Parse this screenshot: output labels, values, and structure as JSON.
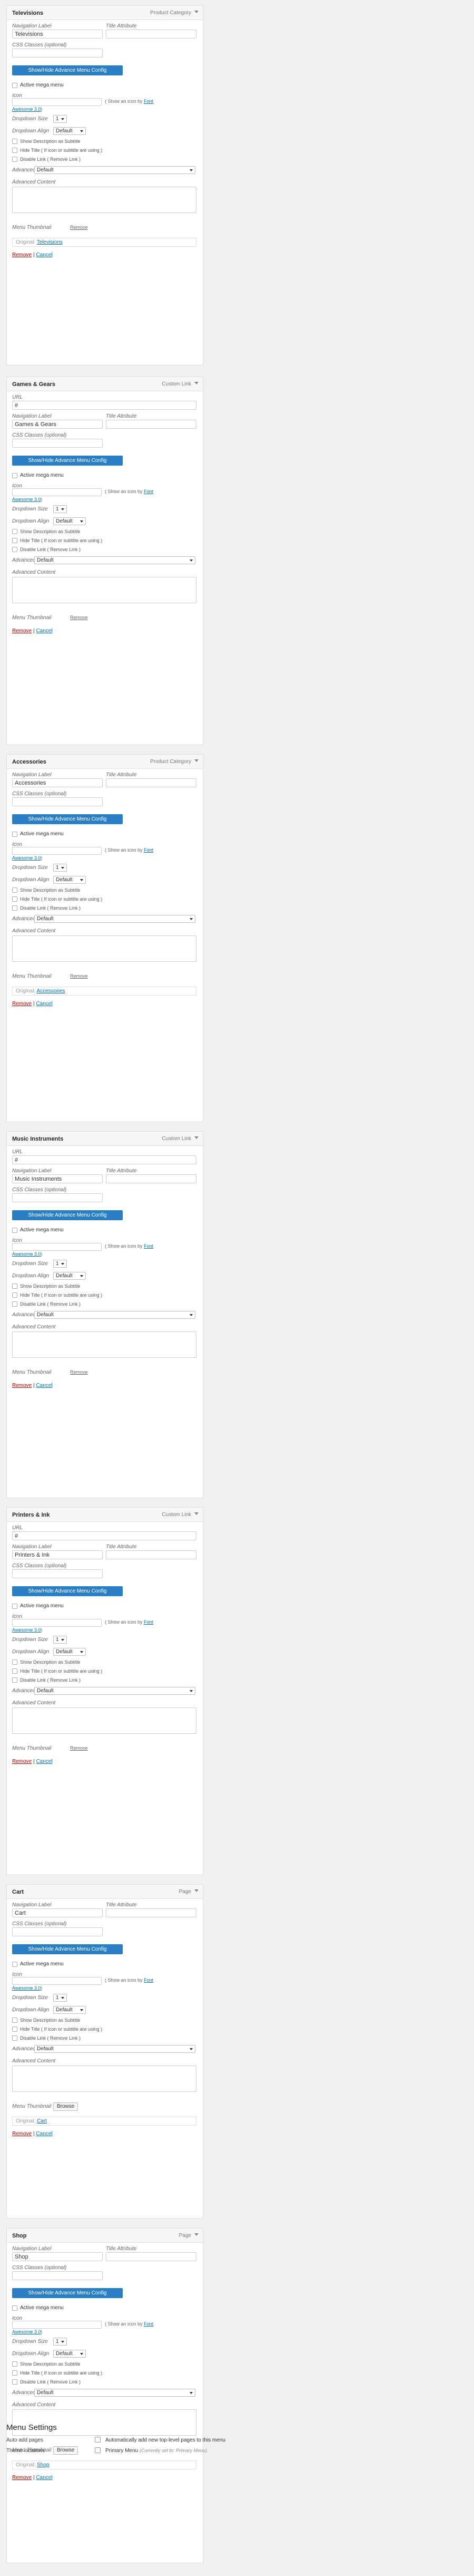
{
  "labels": {
    "url": "URL",
    "navigation_label": "Navigation Label",
    "title_attribute": "Title Attribute",
    "css_classes": "CSS Classes (optional)",
    "advance_button": "Show/Hide Advance Menu Config",
    "active_mega_menu": "Active mega menu",
    "icon": "Icon",
    "icon_hint_prefix": "( Show an icon by",
    "icon_hint_font": "Font",
    "icon_hint_awesome": "Awesome 3.0",
    "icon_hint_suffix": ")",
    "dropdown_size": "Dropdown Size",
    "dropdown_align": "Dropdown Align",
    "show_description": "Show Description as Subtitle",
    "hide_title": "Hide Title ( If icon or subtitle are using )",
    "disable_link": "Disable Link ( Remove Link )",
    "advanced": "Advanced",
    "advanced_content": "Advanced Content",
    "menu_thumbnail": "Menu Thumbnail",
    "remove_thumb": "Remove",
    "browse": "Browse",
    "original": "Original:",
    "remove": "Remove",
    "sep": "|",
    "cancel": "Cancel"
  },
  "items": [
    {
      "title": "Televisions",
      "type": "Product Category",
      "label_value": "Televisions",
      "size": "1",
      "align": "Default",
      "advanced": "Default",
      "original": "Televisions"
    },
    {
      "title": "Games & Gears",
      "type": "Custom Link",
      "url_value": "#",
      "label_value": "Games & Gears",
      "size": "1",
      "align": "Default",
      "advanced": "Default"
    },
    {
      "title": "Accessories",
      "type": "Product Category",
      "label_value": "Accessories",
      "size": "1",
      "align": "Default",
      "advanced": "Default",
      "original": "Accessories"
    },
    {
      "title": "Music Instruments",
      "type": "Custom Link",
      "url_value": "#",
      "label_value": "Music Instruments",
      "size": "1",
      "align": "Default",
      "advanced": "Default"
    },
    {
      "title": "Printers & Ink",
      "type": "Custom Link",
      "url_value": "#",
      "label_value": "Printers & Ink",
      "size": "1",
      "align": "Default",
      "advanced": "Default"
    },
    {
      "title": "Cart",
      "type": "Page",
      "label_value": "Cart",
      "size": "1",
      "align": "Default",
      "advanced": "Default",
      "original": "Cart",
      "browse": true
    },
    {
      "title": "Shop",
      "type": "Page",
      "label_value": "Shop",
      "size": "1",
      "align": "Default",
      "advanced": "Default",
      "original": "Shop",
      "browse": true
    }
  ],
  "menu_settings": {
    "title": "Menu Settings",
    "auto_add_label": "Auto add pages",
    "auto_add_text": "Automatically add new top-level pages to this menu",
    "theme_locations_label": "Theme locations",
    "primary_menu_text": "Primary Menu",
    "primary_menu_note": "(Currently set to: Primary Menu)"
  }
}
